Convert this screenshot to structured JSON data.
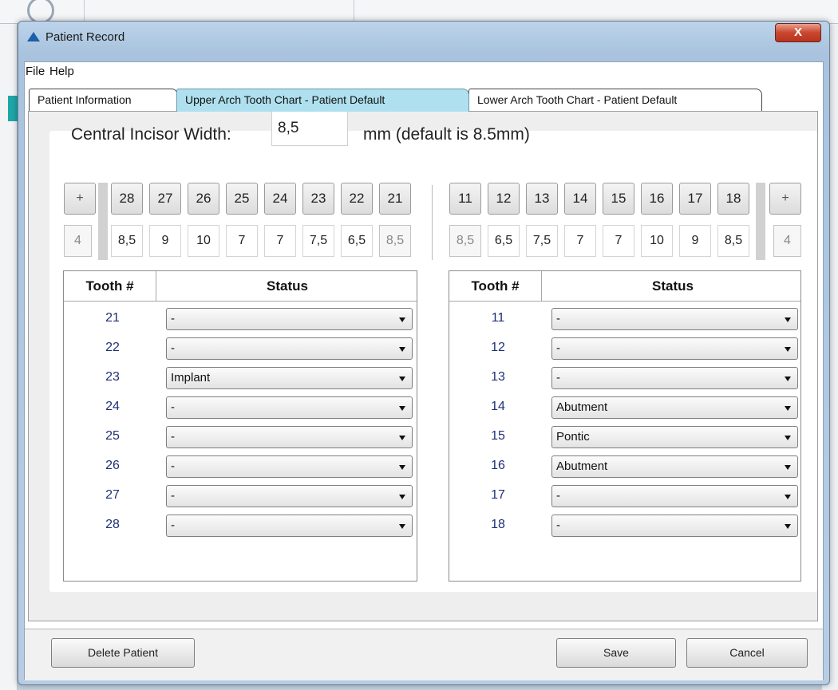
{
  "window": {
    "title": "Patient Record",
    "close_glyph": "X"
  },
  "menu": [
    "File",
    "Help"
  ],
  "tabs": [
    "Patient Information",
    "Upper Arch Tooth Chart - Patient Default",
    "Lower Arch Tooth Chart - Patient Default"
  ],
  "incisor": {
    "label": "Central Incisor Width:",
    "value": "8,5",
    "unit": "mm (default is 8.5mm)"
  },
  "left_arch": {
    "plus": "+",
    "count": "4",
    "teeth": [
      "28",
      "27",
      "26",
      "25",
      "24",
      "23",
      "22",
      "21"
    ],
    "widths": [
      "8,5",
      "9",
      "10",
      "7",
      "7",
      "7,5",
      "6,5",
      "8,5"
    ]
  },
  "right_arch": {
    "plus": "+",
    "count": "4",
    "teeth": [
      "11",
      "12",
      "13",
      "14",
      "15",
      "16",
      "17",
      "18"
    ],
    "widths": [
      "8,5",
      "6,5",
      "7,5",
      "7",
      "7",
      "10",
      "9",
      "8,5"
    ]
  },
  "tables": {
    "col_tooth": "Tooth #",
    "col_status": "Status",
    "left_rows": [
      {
        "tooth": "21",
        "status": "-"
      },
      {
        "tooth": "22",
        "status": "-"
      },
      {
        "tooth": "23",
        "status": "Implant"
      },
      {
        "tooth": "24",
        "status": "-"
      },
      {
        "tooth": "25",
        "status": "-"
      },
      {
        "tooth": "26",
        "status": "-"
      },
      {
        "tooth": "27",
        "status": "-"
      },
      {
        "tooth": "28",
        "status": "-"
      }
    ],
    "right_rows": [
      {
        "tooth": "11",
        "status": "-"
      },
      {
        "tooth": "12",
        "status": "-"
      },
      {
        "tooth": "13",
        "status": "-"
      },
      {
        "tooth": "14",
        "status": "Abutment"
      },
      {
        "tooth": "15",
        "status": "Pontic"
      },
      {
        "tooth": "16",
        "status": "Abutment"
      },
      {
        "tooth": "17",
        "status": "-"
      },
      {
        "tooth": "18",
        "status": "-"
      }
    ]
  },
  "footer": {
    "delete_label": "Delete Patient",
    "save_label": "Save",
    "cancel_label": "Cancel"
  },
  "colors": {
    "accent_tab": "#aee0ef",
    "tooth_number_text": "#1f2f78",
    "close_button": "#c9462f"
  },
  "icons": {
    "app_logo": "triangle-logo-icon",
    "dropdown": "caret-down-icon",
    "search": "magnifier-icon"
  }
}
